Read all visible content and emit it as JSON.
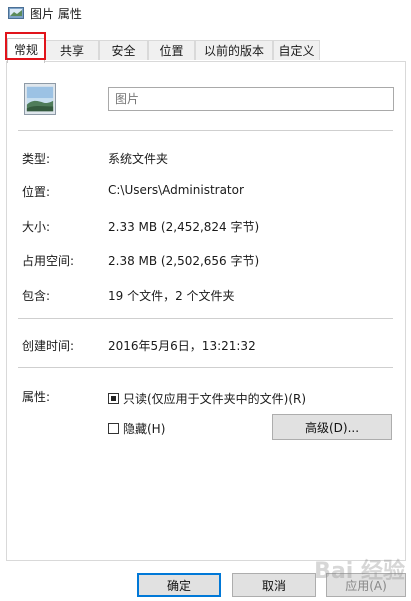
{
  "window": {
    "title": "图片 属性",
    "icon": "folder-icon"
  },
  "tabs": [
    {
      "label": "常规",
      "active": true
    },
    {
      "label": "共享"
    },
    {
      "label": "安全"
    },
    {
      "label": "位置"
    },
    {
      "label": "以前的版本"
    },
    {
      "label": "自定义"
    }
  ],
  "general": {
    "folder_name_placeholder": "图片",
    "properties": [
      {
        "label": "类型:",
        "value": "系统文件夹"
      },
      {
        "label": "位置:",
        "value": "C:\\Users\\Administrator"
      },
      {
        "label": "大小:",
        "value": "2.33 MB (2,452,824 字节)"
      },
      {
        "label": "占用空间:",
        "value": "2.38 MB (2,502,656 字节)"
      },
      {
        "label": "包含:",
        "value": "19 个文件，2 个文件夹"
      }
    ],
    "created": {
      "label": "创建时间:",
      "value": "2016年5月6日，13:21:32"
    },
    "attributes": {
      "label": "属性:",
      "readonly_label": "只读(仅应用于文件夹中的文件)(R)",
      "hidden_label": "隐藏(H)",
      "advanced_button": "高级(D)..."
    }
  },
  "buttons": {
    "ok": "确定",
    "cancel": "取消",
    "apply": "应用(A)"
  },
  "watermark": "Bai 经验"
}
